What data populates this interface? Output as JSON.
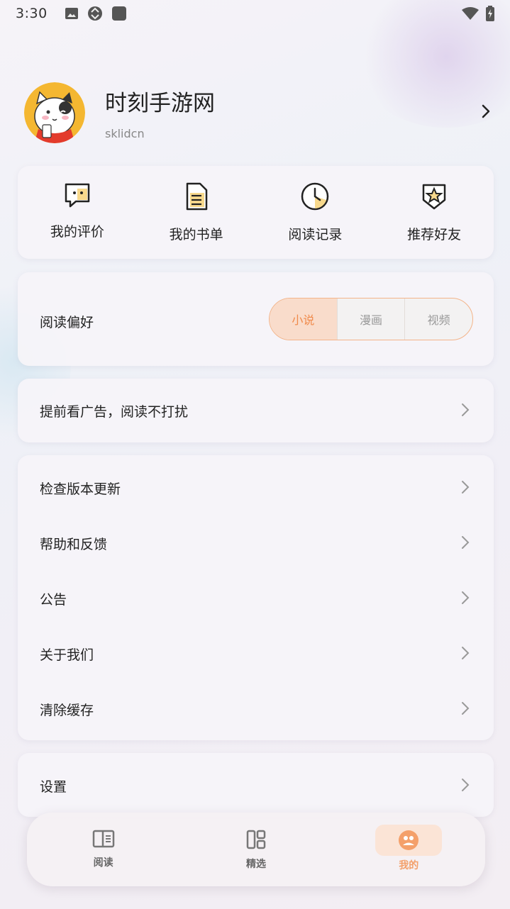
{
  "status_bar": {
    "time": "3:30"
  },
  "profile": {
    "name": "时刻手游网",
    "id": "sklidcn"
  },
  "quick_actions": [
    {
      "label": "我的评价",
      "icon": "comment-icon"
    },
    {
      "label": "我的书单",
      "icon": "document-icon"
    },
    {
      "label": "阅读记录",
      "icon": "clock-icon"
    },
    {
      "label": "推荐好友",
      "icon": "star-shield-icon"
    }
  ],
  "reading_pref": {
    "label": "阅读偏好",
    "options": [
      "小说",
      "漫画",
      "视频"
    ],
    "selected": "小说"
  },
  "ads_row": {
    "label": "提前看广告，阅读不打扰"
  },
  "menu": [
    {
      "label": "检查版本更新"
    },
    {
      "label": "帮助和反馈"
    },
    {
      "label": "公告"
    },
    {
      "label": "关于我们"
    },
    {
      "label": "清除缓存"
    }
  ],
  "settings_row": {
    "label": "设置"
  },
  "tabs": [
    {
      "label": "阅读",
      "icon": "book-icon"
    },
    {
      "label": "精选",
      "icon": "grid-icon"
    },
    {
      "label": "我的",
      "icon": "profile-icon",
      "active": true
    }
  ],
  "colors": {
    "accent": "#f4a06a",
    "accent_bg": "#fbe4d6"
  }
}
